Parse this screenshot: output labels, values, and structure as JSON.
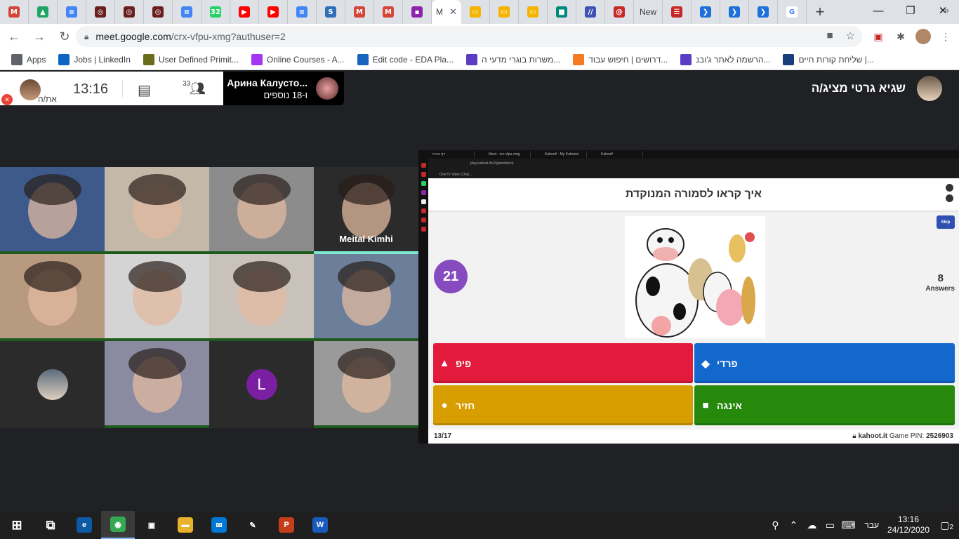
{
  "browser": {
    "tabs": [
      {
        "icon": "gmail-icon",
        "color": "#d44638",
        "glyph": "M"
      },
      {
        "icon": "drive-icon",
        "color": "#1fa463",
        "glyph": "▲"
      },
      {
        "icon": "docs-icon",
        "color": "#4285f4",
        "glyph": "≡"
      },
      {
        "icon": "eda-icon",
        "color": "#6b1e1e",
        "glyph": "◎"
      },
      {
        "icon": "eda-icon",
        "color": "#6b1e1e",
        "glyph": "◎"
      },
      {
        "icon": "eda-icon",
        "color": "#6b1e1e",
        "glyph": "◎"
      },
      {
        "icon": "docs-icon",
        "color": "#4285f4",
        "glyph": "≡"
      },
      {
        "icon": "whatsapp-icon",
        "color": "#25d366",
        "glyph": "32"
      },
      {
        "icon": "youtube-icon",
        "color": "#ff0000",
        "glyph": "▶"
      },
      {
        "icon": "youtube-icon",
        "color": "#ff0000",
        "glyph": "▶"
      },
      {
        "icon": "docs-icon",
        "color": "#4285f4",
        "glyph": "≡"
      },
      {
        "icon": "s-icon",
        "color": "#2e6fb8",
        "glyph": "S"
      },
      {
        "icon": "gmail-icon",
        "color": "#d44638",
        "glyph": "M"
      },
      {
        "icon": "gmail-icon",
        "color": "#d44638",
        "glyph": "M"
      },
      {
        "icon": "classroom-icon",
        "color": "#8e24aa",
        "glyph": "▪"
      }
    ],
    "active_tab_label": "M",
    "tabs_after": [
      {
        "icon": "slides-icon",
        "color": "#f4b400",
        "glyph": "▭"
      },
      {
        "icon": "slides-icon",
        "color": "#f4b400",
        "glyph": "▭"
      },
      {
        "icon": "slides-icon",
        "color": "#f4b400",
        "glyph": "▭"
      },
      {
        "icon": "meet-icon",
        "color": "#00897b",
        "glyph": "■"
      },
      {
        "icon": "generic-icon",
        "color": "#3f51b5",
        "glyph": "//"
      },
      {
        "icon": "lollipop-icon",
        "color": "#c62828",
        "glyph": "@"
      }
    ],
    "new_tab_label": "New",
    "tabs_tail": [
      {
        "icon": "red-box-icon",
        "color": "#c62828",
        "glyph": "☰"
      },
      {
        "icon": "bubble-icon",
        "color": "#1e6fd9",
        "glyph": "❯"
      },
      {
        "icon": "bubble-icon",
        "color": "#1e6fd9",
        "glyph": "❯"
      },
      {
        "icon": "bubble-icon",
        "color": "#1e6fd9",
        "glyph": "❯"
      },
      {
        "icon": "google-icon",
        "color": "#ffffff",
        "glyph": "G"
      }
    ],
    "url_host": "meet.google.com",
    "url_path": "/crx-vfpu-xmg?authuser=2",
    "bookmarks": [
      {
        "label": "Apps",
        "icon": "apps-icon",
        "color": "#5f6368"
      },
      {
        "label": "Jobs | LinkedIn",
        "icon": "linkedin-icon",
        "color": "#0a66c2"
      },
      {
        "label": "User Defined Primit...",
        "icon": "udp-icon",
        "color": "#6b6b1e"
      },
      {
        "label": "Online Courses - A...",
        "icon": "udemy-icon",
        "color": "#a435f0"
      },
      {
        "label": "Edit code - EDA Pla...",
        "icon": "eda-playground-icon",
        "color": "#1565c0"
      },
      {
        "label": "משרות בוגרי מדעי ה...",
        "icon": "jobmaster-icon",
        "color": "#5b3cc4"
      },
      {
        "label": "דרושים | חיפוש עבוד...",
        "icon": "alljobs-icon",
        "color": "#f47b20"
      },
      {
        "label": "הרשמה לאתר ג'ובנ...",
        "icon": "jobnet-icon",
        "color": "#5b3cc4"
      },
      {
        "label": "שליחת קורות חיים |...",
        "icon": "jobinfo-icon",
        "color": "#1a3d7c"
      }
    ]
  },
  "meet": {
    "self_label": "את/ה",
    "time": "13:16",
    "participant_count": "33",
    "presenter_card_name": "Арина Калусто...",
    "presenter_card_more": "ו-18 נוספים",
    "presenting_label": "שגיא גרטי מציג/ה",
    "tiles": [
      {
        "bg": "#3e5a8a",
        "bar": "green"
      },
      {
        "bg": "#c4b8a8",
        "bar": "green"
      },
      {
        "bg": "#8c8c8c",
        "bar": "green"
      },
      {
        "bg": "#2b2b2b",
        "bar": "teal",
        "name": "Meital Kimhi"
      },
      {
        "bg": "#b89a80",
        "bar": "green"
      },
      {
        "bg": "#d4d4d4",
        "bar": "green"
      },
      {
        "bg": "#c9c2ba",
        "bar": "green"
      },
      {
        "bg": "#6c7f9a",
        "bar": "green"
      },
      {
        "bg": "#2b2b2b",
        "bar": "none",
        "avatar": true
      },
      {
        "bg": "#8a8aa0",
        "bar": "green"
      },
      {
        "bg": "#2b2b2b",
        "bar": "none",
        "letter": "L",
        "letter_color": "#7b1fa2"
      },
      {
        "bg": "#9a9a9a",
        "bar": "green"
      }
    ]
  },
  "kahoot": {
    "inner_tabs": [
      "דף הבית",
      "Meet - crx-vfpu-xmg",
      "Kahoot! - My Kahoots",
      "Kahoot!"
    ],
    "inner_url": "play.kahoot.it/v2/gameblock",
    "inner_bookmark": "OneTV Video Chat...",
    "question": "איך קראו לסמורה המנוקדת",
    "timer": "21",
    "skip_label": "Skip",
    "answers_count": "8",
    "answers_label": "Answers",
    "options": [
      {
        "text": "פיפ",
        "shape": "▲",
        "color": "#e21b3c"
      },
      {
        "text": "פרדי",
        "shape": "◆",
        "color": "#1368ce"
      },
      {
        "text": "חזיר",
        "shape": "●",
        "color": "#d89e00"
      },
      {
        "text": "אינגה",
        "shape": "■",
        "color": "#26890c"
      }
    ],
    "progress": "13/17",
    "brand": "kahoot.it",
    "pin_label": "Game PIN:",
    "pin": "2526903"
  },
  "taskbar": {
    "apps": [
      {
        "icon": "windows-start-icon",
        "glyph": "⊞",
        "color": "#1f1f1f"
      },
      {
        "icon": "task-view-icon",
        "glyph": "⧉",
        "color": "#1f1f1f"
      },
      {
        "icon": "edge-icon",
        "glyph": "e",
        "color": "#0c59a4"
      },
      {
        "icon": "chrome-icon",
        "glyph": "◉",
        "color": "#34a853",
        "active": true
      },
      {
        "icon": "store-icon",
        "glyph": "▣",
        "color": "#1f1f1f"
      },
      {
        "icon": "file-explorer-icon",
        "glyph": "▬",
        "color": "#e8b22a"
      },
      {
        "icon": "mail-icon",
        "glyph": "✉",
        "color": "#0078d4"
      },
      {
        "icon": "paint-icon",
        "glyph": "✎",
        "color": "#1f1f1f"
      },
      {
        "icon": "powerpoint-icon",
        "glyph": "P",
        "color": "#c43e1c"
      },
      {
        "icon": "word-icon",
        "glyph": "W",
        "color": "#185abd"
      }
    ],
    "language": "עבר",
    "time": "13:16",
    "date": "24/12/2020",
    "notifications": "2"
  }
}
